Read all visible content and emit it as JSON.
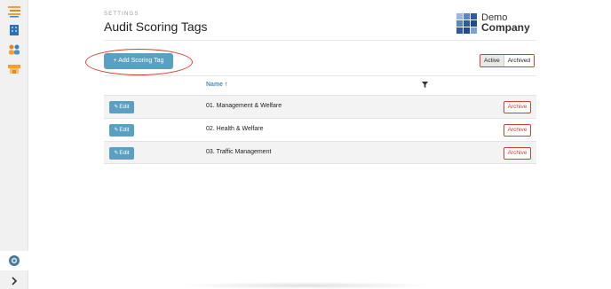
{
  "sidebar": {
    "icons": [
      "list-icon",
      "building-icon",
      "users-icon",
      "site-icon"
    ],
    "settings_icon": "gear-icon",
    "expand_icon": "chevron-right-icon"
  },
  "header": {
    "eyebrow": "SETTINGS",
    "title": "Audit Scoring Tags",
    "logo": {
      "line1": "Demo",
      "line2": "Company"
    }
  },
  "toolbar": {
    "add_label": "+ Add Scoring Tag",
    "toggle": {
      "active": "Active",
      "archived": "Archived"
    }
  },
  "table": {
    "column_name": "Name",
    "sort_indicator": "↑",
    "edit_label": "Edit",
    "archive_label": "Archive",
    "rows": [
      {
        "name": "01. Management & Welfare"
      },
      {
        "name": "02. Health & Welfare"
      },
      {
        "name": "03. Traffic Management"
      }
    ]
  },
  "colors": {
    "accent": "#5aa0c2",
    "danger": "#d04030",
    "highlight": "#d7402b"
  }
}
